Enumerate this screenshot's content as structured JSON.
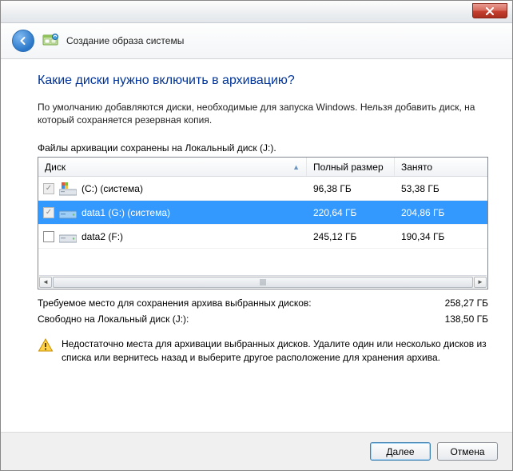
{
  "titlebar": {
    "close_tooltip": "Close"
  },
  "header": {
    "title": "Создание образа системы"
  },
  "main": {
    "question": "Какие диски нужно включить в архивацию?",
    "description": "По умолчанию добавляются диски, необходимые для запуска Windows. Нельзя добавить диск, на который сохраняется резервная копия.",
    "saved_on": "Файлы архивации сохранены на Локальный диск (J:).",
    "columns": {
      "disk": "Диск",
      "size": "Полный размер",
      "used": "Занято"
    },
    "rows": [
      {
        "label": "(C:) (система)",
        "size": "96,38 ГБ",
        "used": "53,38 ГБ",
        "checked": true,
        "disabled": true,
        "selected": false,
        "iconType": "win"
      },
      {
        "label": "data1 (G:) (система)",
        "size": "220,64 ГБ",
        "used": "204,86 ГБ",
        "checked": true,
        "disabled": true,
        "selected": true,
        "iconType": "hdd"
      },
      {
        "label": "data2 (F:)",
        "size": "245,12 ГБ",
        "used": "190,34 ГБ",
        "checked": false,
        "disabled": false,
        "selected": false,
        "iconType": "hdd"
      }
    ],
    "summary": {
      "required_label": "Требуемое место для сохранения архива выбранных дисков:",
      "required_value": "258,27 ГБ",
      "free_label": "Свободно на Локальный диск (J:):",
      "free_value": "138,50 ГБ"
    },
    "warning": "Недостаточно места для архивации выбранных дисков. Удалите один или несколько дисков из списка или вернитесь назад и выберите другое расположение для хранения архива."
  },
  "footer": {
    "next": "Далее",
    "cancel": "Отмена"
  }
}
